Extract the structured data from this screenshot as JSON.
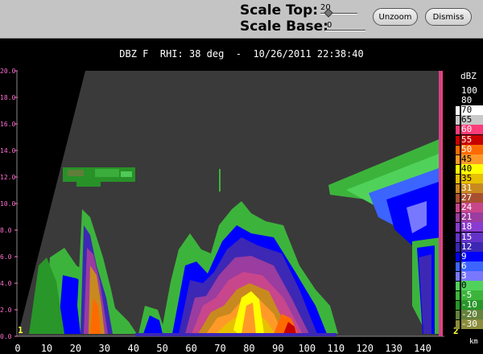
{
  "controls": {
    "scale_top_label": "Scale Top:",
    "scale_top_value": "20",
    "scale_base_label": "Scale Base:",
    "scale_base_value": "0",
    "unzoom_label": "Unzoom",
    "dismiss_label": "Dismiss"
  },
  "title": "DBZ F  RHI: 38 deg  -  10/26/2011 22:38:40",
  "y_ticks": [
    "20.0",
    "18.0",
    "16.0",
    "14.0",
    "12.0",
    "10.0",
    "8.0",
    "6.0",
    "4.0",
    "2.0",
    "0.0"
  ],
  "x_ticks": [
    "0",
    "10",
    "20",
    "30",
    "40",
    "50",
    "60",
    "70",
    "80",
    "90",
    "100",
    "110",
    "120",
    "130",
    "140"
  ],
  "x_unit": "km",
  "legend": {
    "title": "dBZ",
    "entries": [
      {
        "label": "100",
        "color": "#000000"
      },
      {
        "label": "80",
        "color": "#000000"
      },
      {
        "label": "70",
        "color": "#ffffff"
      },
      {
        "label": "65",
        "color": "#c8c8c8"
      },
      {
        "label": "60",
        "color": "#ff3c78"
      },
      {
        "label": "55",
        "color": "#c80000"
      },
      {
        "label": "50",
        "color": "#ff6a00"
      },
      {
        "label": "45",
        "color": "#ff9a28"
      },
      {
        "label": "40",
        "color": "#ffff00"
      },
      {
        "label": "35",
        "color": "#e8c000"
      },
      {
        "label": "31",
        "color": "#c88a1e"
      },
      {
        "label": "27",
        "color": "#a85030"
      },
      {
        "label": "24",
        "color": "#c8468c"
      },
      {
        "label": "21",
        "color": "#9a3ca0"
      },
      {
        "label": "18",
        "color": "#8a3cd2"
      },
      {
        "label": "15",
        "color": "#6432c8"
      },
      {
        "label": "12",
        "color": "#3c28b4"
      },
      {
        "label": "9",
        "color": "#0000ff"
      },
      {
        "label": "6",
        "color": "#3c64ff"
      },
      {
        "label": "3",
        "color": "#7878ff"
      },
      {
        "label": "0",
        "color": "#50d25a"
      },
      {
        "label": "-5",
        "color": "#3cb43c"
      },
      {
        "label": "-10",
        "color": "#289628"
      },
      {
        "label": "-20",
        "color": "#64823c"
      },
      {
        "label": "-30",
        "color": "#8c8c3c"
      }
    ]
  },
  "corner_left": "1",
  "corner_right": "2"
}
